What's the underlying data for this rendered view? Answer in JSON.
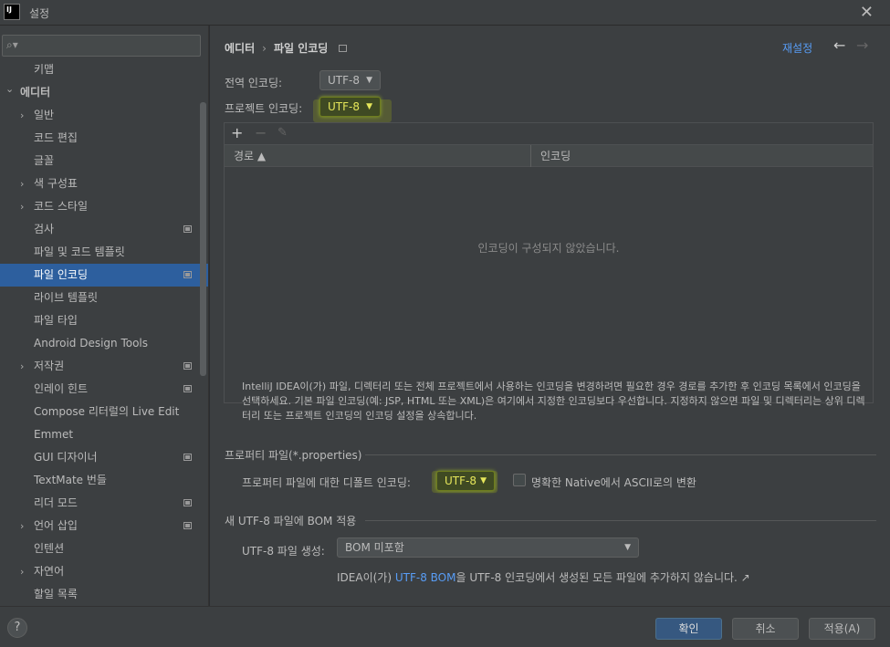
{
  "window": {
    "title": "설정",
    "app_icon_text": "IJ"
  },
  "search": {
    "placeholder": ""
  },
  "sidebar": {
    "items": [
      {
        "label": "키맵",
        "indent": 1,
        "arrow": ""
      },
      {
        "label": "에디터",
        "indent": 0,
        "arrow": "⌄"
      },
      {
        "label": "일반",
        "indent": 1,
        "arrow": "›"
      },
      {
        "label": "코드 편집",
        "indent": 2,
        "arrow": ""
      },
      {
        "label": "글꼴",
        "indent": 2,
        "arrow": ""
      },
      {
        "label": "색 구성표",
        "indent": 1,
        "arrow": "›"
      },
      {
        "label": "코드 스타일",
        "indent": 1,
        "arrow": "›"
      },
      {
        "label": "검사",
        "indent": 2,
        "arrow": "",
        "badge": true
      },
      {
        "label": "파일 및 코드 템플릿",
        "indent": 2,
        "arrow": ""
      },
      {
        "label": "파일 인코딩",
        "indent": 2,
        "arrow": "",
        "badge": true,
        "selected": true
      },
      {
        "label": "라이브 템플릿",
        "indent": 2,
        "arrow": ""
      },
      {
        "label": "파일 타입",
        "indent": 2,
        "arrow": ""
      },
      {
        "label": "Android Design Tools",
        "indent": 2,
        "arrow": ""
      },
      {
        "label": "저작권",
        "indent": 1,
        "arrow": "›",
        "badge": true
      },
      {
        "label": "인레이 힌트",
        "indent": 2,
        "arrow": "",
        "badge": true
      },
      {
        "label": "Compose 리터럴의 Live Edit",
        "indent": 2,
        "arrow": ""
      },
      {
        "label": "Emmet",
        "indent": 2,
        "arrow": ""
      },
      {
        "label": "GUI 디자이너",
        "indent": 2,
        "arrow": "",
        "badge": true
      },
      {
        "label": "TextMate 번들",
        "indent": 2,
        "arrow": ""
      },
      {
        "label": "리더 모드",
        "indent": 2,
        "arrow": "",
        "badge": true
      },
      {
        "label": "언어 삽입",
        "indent": 1,
        "arrow": "›",
        "badge": true
      },
      {
        "label": "인텐션",
        "indent": 2,
        "arrow": ""
      },
      {
        "label": "자연어",
        "indent": 1,
        "arrow": "›"
      },
      {
        "label": "할일 목록",
        "indent": 2,
        "arrow": ""
      }
    ]
  },
  "header": {
    "crumb_parent": "에디터",
    "crumb_sep": "›",
    "crumb_current": "파일 인코딩",
    "reset_label": "재설정",
    "back": "←",
    "forward": "→"
  },
  "encoding": {
    "global_label": "전역 인코딩:",
    "global_value": "UTF-8",
    "project_label": "프로젝트 인코딩:",
    "project_value": "UTF-8"
  },
  "table": {
    "add": "+",
    "remove": "−",
    "edit": "✎",
    "col_path": "경로 ▲",
    "col_encoding": "인코딩",
    "empty": "인코딩이 구성되지 않았습니다."
  },
  "description": "IntelliJ IDEA이(가) 파일, 디렉터리 또는 전체 프로젝트에서 사용하는 인코딩을 변경하려면 필요한 경우 경로를 추가한 후 인코딩 목록에서 인코딩을 선택하세요. 기본 파일 인코딩(예: JSP, HTML 또는 XML)은 여기에서 지정한 인코딩보다 우선합니다. 지정하지 않으면 파일 및 디렉터리는 상위 디렉터리 또는 프로젝트 인코딩의 인코딩 설정을 상속합니다.",
  "properties": {
    "section_title": "프로퍼티 파일(*.properties)",
    "default_label": "프로퍼티 파일에 대한 디폴트 인코딩:",
    "default_value": "UTF-8",
    "native_label": "명확한 Native에서 ASCII로의 변환",
    "native_checked": false
  },
  "bom": {
    "section_title": "새 UTF-8 파일에 BOM 적용",
    "create_label": "UTF-8 파일 생성:",
    "create_value": "BOM 미포함",
    "note_prefix": "IDEA이(가) ",
    "note_link": "UTF-8 BOM",
    "note_suffix": "을 UTF-8 인코딩에서 생성된 모든 파일에 추가하지 않습니다. ↗"
  },
  "footer": {
    "help": "?",
    "ok": "확인",
    "cancel": "취소",
    "apply": "적용(A)"
  },
  "colors": {
    "accent": "#589df6",
    "selection": "#2d5f9e",
    "highlight": "#8ea62a"
  }
}
